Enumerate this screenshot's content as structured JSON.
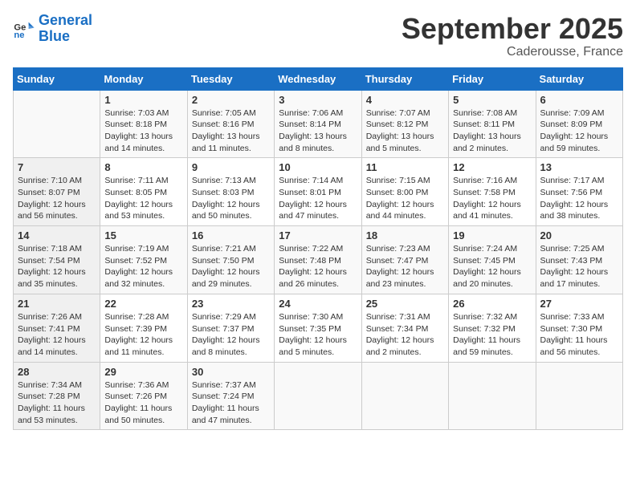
{
  "header": {
    "logo_line1": "General",
    "logo_line2": "Blue",
    "month": "September 2025",
    "location": "Caderousse, France"
  },
  "days_of_week": [
    "Sunday",
    "Monday",
    "Tuesday",
    "Wednesday",
    "Thursday",
    "Friday",
    "Saturday"
  ],
  "weeks": [
    [
      {
        "day": "",
        "info": ""
      },
      {
        "day": "1",
        "info": "Sunrise: 7:03 AM\nSunset: 8:18 PM\nDaylight: 13 hours\nand 14 minutes."
      },
      {
        "day": "2",
        "info": "Sunrise: 7:05 AM\nSunset: 8:16 PM\nDaylight: 13 hours\nand 11 minutes."
      },
      {
        "day": "3",
        "info": "Sunrise: 7:06 AM\nSunset: 8:14 PM\nDaylight: 13 hours\nand 8 minutes."
      },
      {
        "day": "4",
        "info": "Sunrise: 7:07 AM\nSunset: 8:12 PM\nDaylight: 13 hours\nand 5 minutes."
      },
      {
        "day": "5",
        "info": "Sunrise: 7:08 AM\nSunset: 8:11 PM\nDaylight: 13 hours\nand 2 minutes."
      },
      {
        "day": "6",
        "info": "Sunrise: 7:09 AM\nSunset: 8:09 PM\nDaylight: 12 hours\nand 59 minutes."
      }
    ],
    [
      {
        "day": "7",
        "info": "Sunrise: 7:10 AM\nSunset: 8:07 PM\nDaylight: 12 hours\nand 56 minutes."
      },
      {
        "day": "8",
        "info": "Sunrise: 7:11 AM\nSunset: 8:05 PM\nDaylight: 12 hours\nand 53 minutes."
      },
      {
        "day": "9",
        "info": "Sunrise: 7:13 AM\nSunset: 8:03 PM\nDaylight: 12 hours\nand 50 minutes."
      },
      {
        "day": "10",
        "info": "Sunrise: 7:14 AM\nSunset: 8:01 PM\nDaylight: 12 hours\nand 47 minutes."
      },
      {
        "day": "11",
        "info": "Sunrise: 7:15 AM\nSunset: 8:00 PM\nDaylight: 12 hours\nand 44 minutes."
      },
      {
        "day": "12",
        "info": "Sunrise: 7:16 AM\nSunset: 7:58 PM\nDaylight: 12 hours\nand 41 minutes."
      },
      {
        "day": "13",
        "info": "Sunrise: 7:17 AM\nSunset: 7:56 PM\nDaylight: 12 hours\nand 38 minutes."
      }
    ],
    [
      {
        "day": "14",
        "info": "Sunrise: 7:18 AM\nSunset: 7:54 PM\nDaylight: 12 hours\nand 35 minutes."
      },
      {
        "day": "15",
        "info": "Sunrise: 7:19 AM\nSunset: 7:52 PM\nDaylight: 12 hours\nand 32 minutes."
      },
      {
        "day": "16",
        "info": "Sunrise: 7:21 AM\nSunset: 7:50 PM\nDaylight: 12 hours\nand 29 minutes."
      },
      {
        "day": "17",
        "info": "Sunrise: 7:22 AM\nSunset: 7:48 PM\nDaylight: 12 hours\nand 26 minutes."
      },
      {
        "day": "18",
        "info": "Sunrise: 7:23 AM\nSunset: 7:47 PM\nDaylight: 12 hours\nand 23 minutes."
      },
      {
        "day": "19",
        "info": "Sunrise: 7:24 AM\nSunset: 7:45 PM\nDaylight: 12 hours\nand 20 minutes."
      },
      {
        "day": "20",
        "info": "Sunrise: 7:25 AM\nSunset: 7:43 PM\nDaylight: 12 hours\nand 17 minutes."
      }
    ],
    [
      {
        "day": "21",
        "info": "Sunrise: 7:26 AM\nSunset: 7:41 PM\nDaylight: 12 hours\nand 14 minutes."
      },
      {
        "day": "22",
        "info": "Sunrise: 7:28 AM\nSunset: 7:39 PM\nDaylight: 12 hours\nand 11 minutes."
      },
      {
        "day": "23",
        "info": "Sunrise: 7:29 AM\nSunset: 7:37 PM\nDaylight: 12 hours\nand 8 minutes."
      },
      {
        "day": "24",
        "info": "Sunrise: 7:30 AM\nSunset: 7:35 PM\nDaylight: 12 hours\nand 5 minutes."
      },
      {
        "day": "25",
        "info": "Sunrise: 7:31 AM\nSunset: 7:34 PM\nDaylight: 12 hours\nand 2 minutes."
      },
      {
        "day": "26",
        "info": "Sunrise: 7:32 AM\nSunset: 7:32 PM\nDaylight: 11 hours\nand 59 minutes."
      },
      {
        "day": "27",
        "info": "Sunrise: 7:33 AM\nSunset: 7:30 PM\nDaylight: 11 hours\nand 56 minutes."
      }
    ],
    [
      {
        "day": "28",
        "info": "Sunrise: 7:34 AM\nSunset: 7:28 PM\nDaylight: 11 hours\nand 53 minutes."
      },
      {
        "day": "29",
        "info": "Sunrise: 7:36 AM\nSunset: 7:26 PM\nDaylight: 11 hours\nand 50 minutes."
      },
      {
        "day": "30",
        "info": "Sunrise: 7:37 AM\nSunset: 7:24 PM\nDaylight: 11 hours\nand 47 minutes."
      },
      {
        "day": "",
        "info": ""
      },
      {
        "day": "",
        "info": ""
      },
      {
        "day": "",
        "info": ""
      },
      {
        "day": "",
        "info": ""
      }
    ]
  ]
}
